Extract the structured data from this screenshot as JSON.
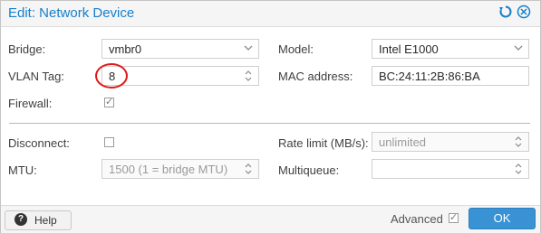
{
  "window": {
    "title": "Edit: Network Device"
  },
  "left": {
    "bridge": {
      "label": "Bridge:",
      "value": "vmbr0"
    },
    "vlan_tag": {
      "label": "VLAN Tag:",
      "value": "8"
    },
    "firewall": {
      "label": "Firewall:",
      "checked": true
    }
  },
  "right": {
    "model": {
      "label": "Model:",
      "value": "Intel E1000"
    },
    "mac": {
      "label": "MAC address:",
      "value": "BC:24:11:2B:86:BA"
    }
  },
  "advanced": {
    "disconnect": {
      "label": "Disconnect:",
      "checked": false
    },
    "mtu": {
      "label": "MTU:",
      "placeholder": "1500 (1 = bridge MTU)"
    },
    "rate_limit": {
      "label": "Rate limit (MB/s):",
      "placeholder": "unlimited"
    },
    "multiqueue": {
      "label": "Multiqueue:",
      "value": ""
    }
  },
  "footer": {
    "help_label": "Help",
    "advanced_label": "Advanced",
    "advanced_checked": true,
    "ok_label": "OK"
  },
  "icons": {
    "reset": "reset-icon",
    "close": "close-icon",
    "help": "help-icon",
    "dropdown": "chevron-down-icon",
    "spinner": "spinner-icon"
  },
  "colors": {
    "accent": "#157fcc",
    "ok_button": "#3892d4",
    "annotation": "#e01818"
  }
}
